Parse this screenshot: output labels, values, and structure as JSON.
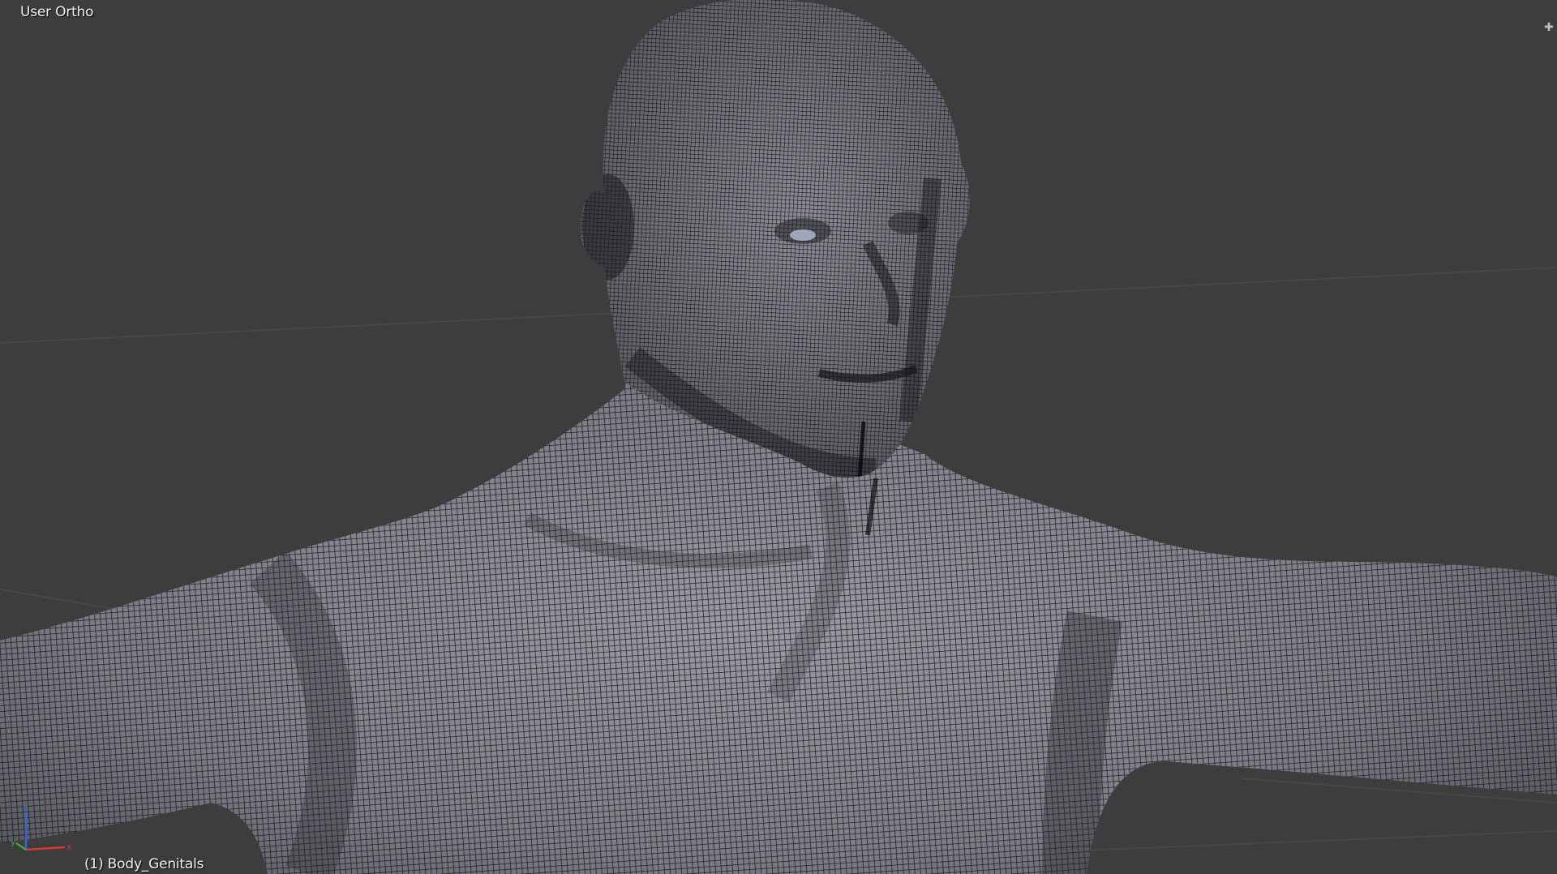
{
  "viewport": {
    "view_label": "User Ortho",
    "object_label": "(1) Body_Genitals",
    "background": "#3d3d3d",
    "mesh_fill": "#8c8c96",
    "wire_color": "#121212"
  },
  "icons": {
    "corner": "plus-icon",
    "gizmo": "axis-gizmo-icon"
  },
  "axis_colors": {
    "x": "#d43a3a",
    "y": "#3ea83e",
    "z": "#3a63d4"
  }
}
